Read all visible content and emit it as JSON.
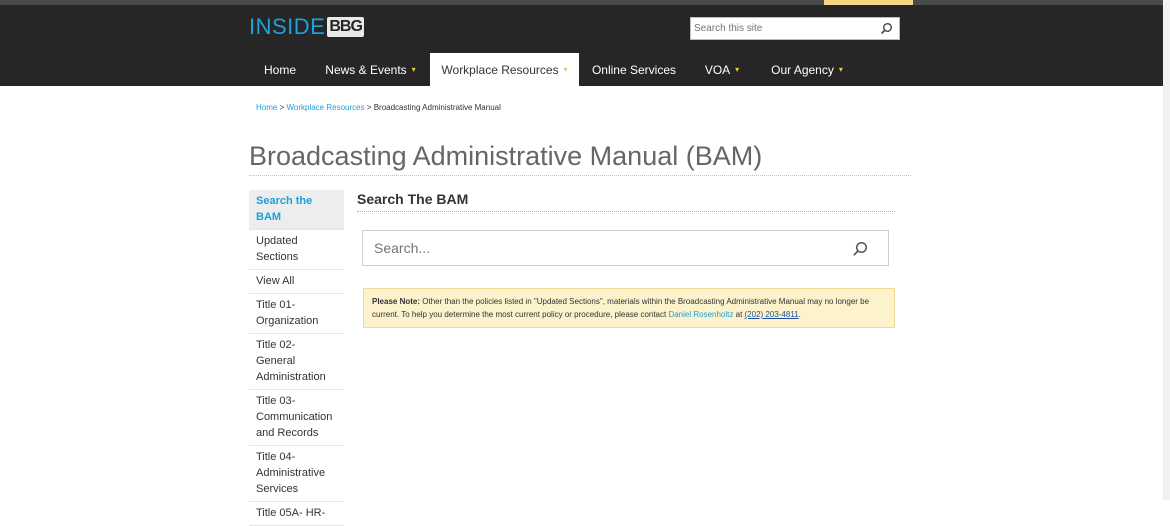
{
  "header": {
    "logo_text": "INSIDE",
    "logo_badge": "BBG",
    "search_placeholder": "Search this site"
  },
  "nav": {
    "items": [
      {
        "label": "Home",
        "caret": ""
      },
      {
        "label": "News & Events",
        "caret": "▾"
      },
      {
        "label": "Workplace Resources",
        "caret": "▾"
      },
      {
        "label": "Online Services",
        "caret": ""
      },
      {
        "label": "VOA",
        "caret": "▾"
      },
      {
        "label": "Our Agency",
        "caret": "▾"
      }
    ]
  },
  "breadcrumb": {
    "home": "Home",
    "sep1": " > ",
    "resources": "Workplace Resources",
    "sep2": " > ",
    "current": "Broadcasting Administrative Manual"
  },
  "page": {
    "title": "Broadcasting Administrative Manual (BAM)"
  },
  "sidebar": {
    "items": [
      {
        "label": "Search the BAM"
      },
      {
        "label": "Updated Sections"
      },
      {
        "label": "View All"
      },
      {
        "label": "Title 01- Organization"
      },
      {
        "label": "Title 02- General Administration"
      },
      {
        "label": "Title 03- Communication and Records"
      },
      {
        "label": "Title 04- Administrative Services"
      },
      {
        "label": "Title 05A- HR-"
      }
    ]
  },
  "main": {
    "section_title": "Search The BAM",
    "search_placeholder": "Search..."
  },
  "note": {
    "label": "Please Note:",
    "text1": " Other than the policies listed in \"Updated Sections\", materials within the Broadcasting Administrative Manual may no longer be current. To help you determine the most current policy or procedure, please contact ",
    "contact": "Daniel Rosenholtz",
    "at": " at ",
    "phone": "(202) 203-4811",
    "end": "."
  }
}
